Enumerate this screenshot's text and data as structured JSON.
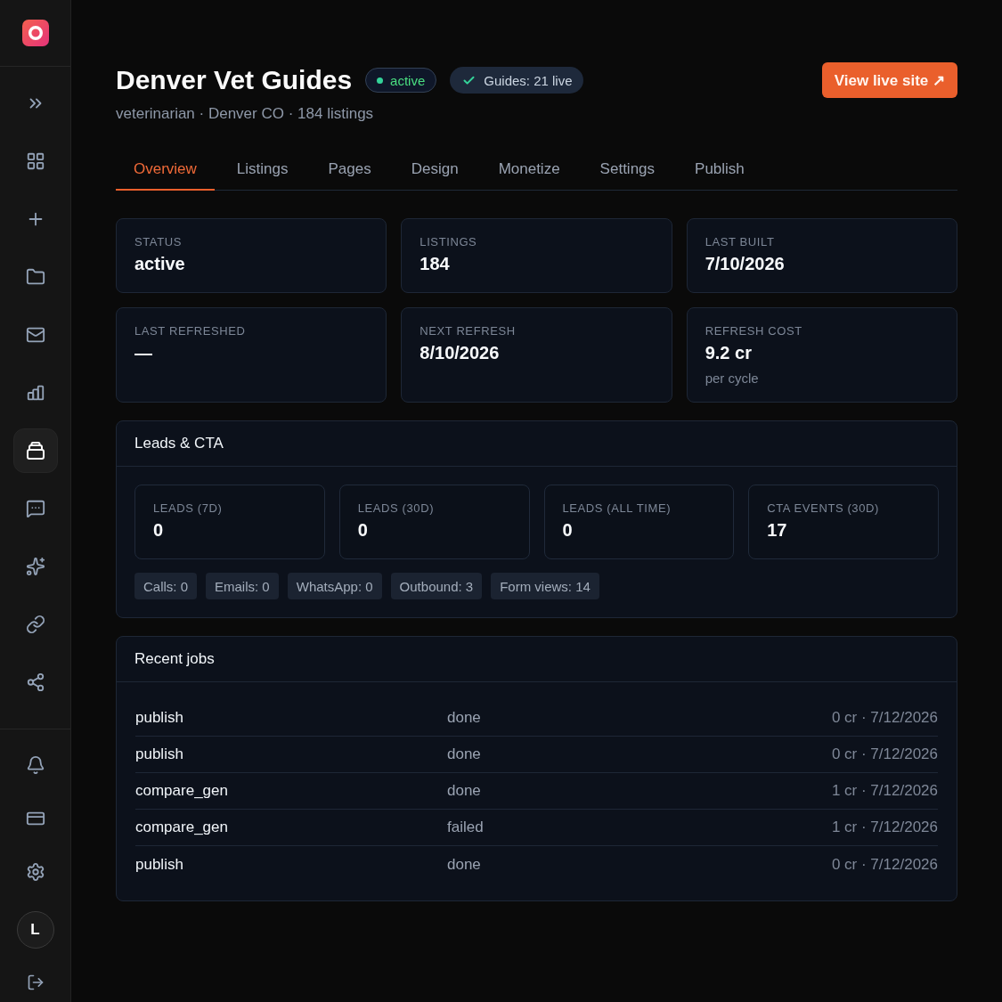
{
  "sidebar": {
    "nav_items": [
      {
        "selected": false
      },
      {
        "selected": false
      },
      {
        "selected": false
      },
      {
        "selected": false
      },
      {
        "selected": false
      },
      {
        "selected": false
      },
      {
        "selected": true
      },
      {
        "selected": false
      },
      {
        "selected": false
      },
      {
        "selected": false
      },
      {
        "selected": false
      }
    ],
    "avatar": {
      "initial": "L"
    }
  },
  "header": {
    "title": "Denver Vet Guides",
    "status_badge": {
      "label": "active"
    },
    "guides_badge": {
      "label": "Guides: 21 live"
    },
    "subtitle": "veterinarian · Denver CO · 184 listings",
    "button": {
      "label": "View live site ↗"
    }
  },
  "tabs": [
    {
      "label": "Overview",
      "selected": true
    },
    {
      "label": "Listings",
      "selected": false
    },
    {
      "label": "Pages",
      "selected": false
    },
    {
      "label": "Design",
      "selected": false
    },
    {
      "label": "Monetize",
      "selected": false
    },
    {
      "label": "Settings",
      "selected": false
    },
    {
      "label": "Publish",
      "selected": false
    }
  ],
  "stats": [
    {
      "label": "STATUS",
      "value": "active"
    },
    {
      "label": "LISTINGS",
      "value": "184"
    },
    {
      "label": "LAST BUILT",
      "value": "7/10/2026"
    },
    {
      "label": "LAST REFRESHED",
      "value": "—"
    },
    {
      "label": "NEXT REFRESH",
      "value": "8/10/2026"
    },
    {
      "label": "REFRESH COST",
      "value": "9.2 cr",
      "note": "per cycle"
    }
  ],
  "leads": {
    "title": "Leads & CTA",
    "metrics": [
      {
        "label": "LEADS (7D)",
        "value": "0"
      },
      {
        "label": "LEADS (30D)",
        "value": "0"
      },
      {
        "label": "LEADS (ALL TIME)",
        "value": "0"
      },
      {
        "label": "CTA EVENTS (30D)",
        "value": "17"
      }
    ],
    "chips": [
      "Calls: 0",
      "Emails: 0",
      "WhatsApp: 0",
      "Outbound: 3",
      "Form views: 14"
    ]
  },
  "jobs": {
    "title": "Recent jobs",
    "rows": [
      {
        "name": "publish",
        "status": "done",
        "meta": "0 cr · 7/12/2026"
      },
      {
        "name": "publish",
        "status": "done",
        "meta": "0 cr · 7/12/2026"
      },
      {
        "name": "compare_gen",
        "status": "done",
        "meta": "1 cr · 7/12/2026"
      },
      {
        "name": "compare_gen",
        "status": "failed",
        "meta": "1 cr · 7/12/2026"
      },
      {
        "name": "publish",
        "status": "done",
        "meta": "0 cr · 7/12/2026"
      }
    ]
  }
}
